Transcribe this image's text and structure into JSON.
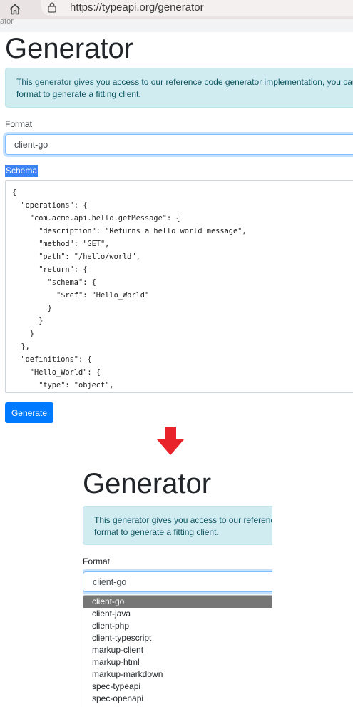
{
  "browser": {
    "url": "https://typeapi.org/generator"
  },
  "breadcrumb": "ator",
  "page": {
    "title": "Generator",
    "alert_line1": "This generator gives you access to our reference code generator implementation, you can",
    "alert_line2": "format to generate a fitting client.",
    "format_label": "Format",
    "format_value": "client-go",
    "schema_label": "Schema",
    "schema_code": "{\n  \"operations\": {\n    \"com.acme.api.hello.getMessage\": {\n      \"description\": \"Returns a hello world message\",\n      \"method\": \"GET\",\n      \"path\": \"/hello/world\",\n      \"return\": {\n        \"schema\": {\n          \"$ref\": \"Hello_World\"\n        }\n      }\n    }\n  },\n  \"definitions\": {\n    \"Hello_World\": {\n      \"type\": \"object\",",
    "generate_label": "Generate"
  },
  "zoom": {
    "title": "Generator",
    "alert_line1": "This generator gives you access to our reference",
    "alert_line2": "format to generate a fitting client.",
    "format_label": "Format",
    "format_value": "client-go",
    "options": [
      "client-go",
      "client-java",
      "client-php",
      "client-typescript",
      "markup-client",
      "markup-html",
      "markup-markdown",
      "spec-typeapi",
      "spec-openapi"
    ],
    "selected_option": "client-go"
  },
  "colors": {
    "primary": "#007bff",
    "alert_bg": "#d1ecf1",
    "alert_text": "#0c5460",
    "arrow": "#e8232a",
    "selection": "#3b82f6",
    "selected_option_bg": "#767676"
  }
}
